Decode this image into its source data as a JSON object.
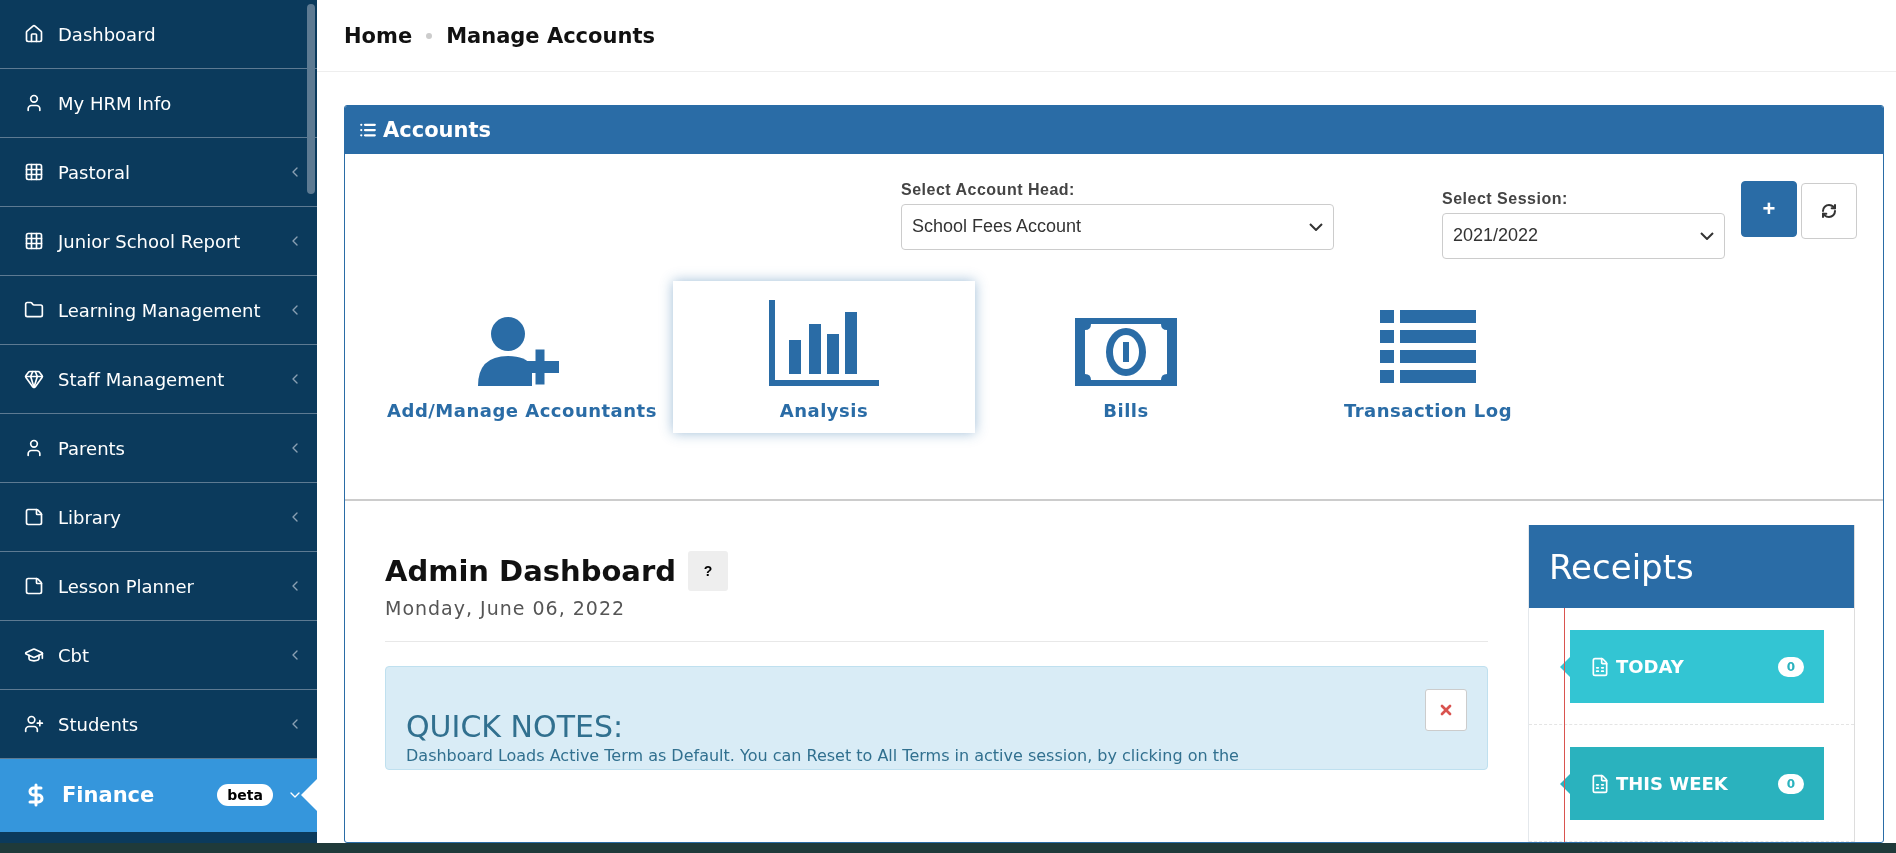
{
  "sidebar": {
    "items": [
      {
        "label": "Dashboard",
        "kind": "link",
        "selected": false
      },
      {
        "label": "My HRM Info",
        "kind": "link",
        "selected": false
      },
      {
        "label": "Pastoral",
        "kind": "menu",
        "expanded": false,
        "selected": false
      },
      {
        "label": "Junior School Report",
        "kind": "menu",
        "expanded": false,
        "selected": false
      },
      {
        "label": "Learning Management",
        "kind": "menu",
        "expanded": false,
        "selected": false
      },
      {
        "label": "Staff Management",
        "kind": "menu",
        "expanded": false,
        "selected": false
      },
      {
        "label": "Parents",
        "kind": "menu",
        "expanded": false,
        "selected": false
      },
      {
        "label": "Library",
        "kind": "menu",
        "expanded": false,
        "selected": false
      },
      {
        "label": "Lesson Planner",
        "kind": "menu",
        "expanded": false,
        "selected": false
      },
      {
        "label": "Cbt",
        "kind": "menu",
        "expanded": false,
        "selected": false
      },
      {
        "label": "Students",
        "kind": "menu",
        "expanded": false,
        "selected": false
      },
      {
        "label": "Finance",
        "kind": "menu",
        "expanded": true,
        "selected": true,
        "badge": "beta"
      }
    ]
  },
  "breadcrumb": [
    "Home",
    "Manage Accounts"
  ],
  "panel": {
    "title": "Accounts",
    "account_head": {
      "label": "Select Account Head:",
      "value": "School Fees Account"
    },
    "session": {
      "label": "Select Session:",
      "value": "2021/2022"
    },
    "add_button": "+",
    "tiles": [
      {
        "label": "Add/Manage Accountants",
        "selected": false
      },
      {
        "label": "Analysis",
        "selected": true
      },
      {
        "label": "Bills",
        "selected": false
      },
      {
        "label": "Transaction Log",
        "selected": false
      }
    ]
  },
  "dashboard": {
    "title": "Admin Dashboard",
    "help": "?",
    "date": "Monday, June 06, 2022",
    "notes": {
      "title": "QUICK NOTES:",
      "text": "Dashboard Loads Active Term as Default. You can Reset to All Terms in active session, by clicking on the"
    }
  },
  "receipts": {
    "title": "Receipts",
    "items": [
      {
        "label": "TODAY",
        "count": "0",
        "color": "#33c5d3"
      },
      {
        "label": "THIS WEEK",
        "count": "0",
        "color": "#2ab2be"
      }
    ]
  }
}
